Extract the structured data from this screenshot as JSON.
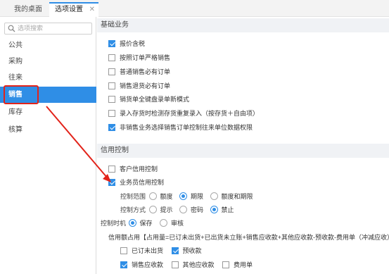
{
  "tabs": [
    {
      "label": "我的桌面"
    },
    {
      "label": "选项设置",
      "close": "✕"
    }
  ],
  "sidebar": {
    "search_placeholder": "选项搜索",
    "items": [
      {
        "label": "公共"
      },
      {
        "label": "采购"
      },
      {
        "label": "往来"
      },
      {
        "label": "销售",
        "active": true
      },
      {
        "label": "库存"
      },
      {
        "label": "核算"
      }
    ]
  },
  "basic": {
    "title": "基础业务",
    "options": [
      {
        "label": "报价含税",
        "checked": true
      },
      {
        "label": "按照订单严格销售",
        "checked": false
      },
      {
        "label": "普通销售必有订单",
        "checked": false
      },
      {
        "label": "销售退货必有订单",
        "checked": false
      },
      {
        "label": "销货单全键盘录单新模式",
        "checked": false
      },
      {
        "label": "录入存货时检测存货重复录入（按存货＋自由项）",
        "checked": false
      },
      {
        "label": "非销售业务选择销售订单控制往来单位数据权限",
        "checked": true
      }
    ]
  },
  "credit": {
    "title": "信用控制",
    "customer": {
      "label": "客户信用控制",
      "checked": false
    },
    "salesman": {
      "label": "业务员信用控制",
      "checked": true
    },
    "scope": {
      "label": "控制范围",
      "options": [
        "额度",
        "期限",
        "额度和期限"
      ],
      "selected": 1
    },
    "method": {
      "label": "控制方式",
      "options": [
        "提示",
        "密码",
        "禁止"
      ],
      "selected": 2
    },
    "timing": {
      "label": "控制时机",
      "options": [
        "保存",
        "审核"
      ],
      "selected": 0
    },
    "formula": "信用额占用【占用量=已订未出货+已出货未立账+销售应收款+其他应收款-预收款-费用单（冲减应收）】",
    "items_row1": [
      {
        "label": "已订未出货",
        "checked": false
      },
      {
        "label": "预收款",
        "checked": true
      }
    ],
    "items_row2": [
      {
        "label": "销售应收款",
        "checked": true
      },
      {
        "label": "其他应收款",
        "checked": false
      },
      {
        "label": "费用单",
        "checked": false
      }
    ]
  },
  "colors": {
    "accent": "#2f8ee6",
    "highlight": "#e2231a"
  }
}
